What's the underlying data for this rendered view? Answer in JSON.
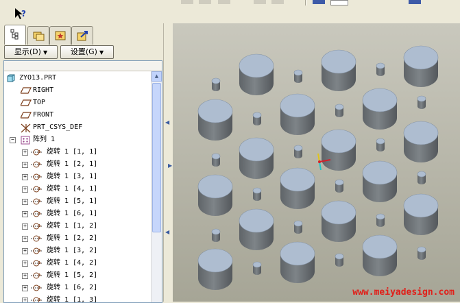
{
  "navigator": {
    "display_label": "显示",
    "display_key": "(D)",
    "settings_label": "设置",
    "settings_key": "(G)"
  },
  "tree": {
    "root": "ZYO13.PRT",
    "items": [
      {
        "label": "RIGHT",
        "type": "datum-plane"
      },
      {
        "label": "TOP",
        "type": "datum-plane"
      },
      {
        "label": "FRONT",
        "type": "datum-plane"
      },
      {
        "label": "PRT_CSYS_DEF",
        "type": "csys"
      }
    ],
    "pattern": {
      "label": "阵列 1",
      "children": [
        "旋转 1 [1, 1]",
        "旋转 1 [2, 1]",
        "旋转 1 [3, 1]",
        "旋转 1 [4, 1]",
        "旋转 1 [5, 1]",
        "旋转 1 [6, 1]",
        "旋转 1 [1, 2]",
        "旋转 1 [2, 2]",
        "旋转 1 [3, 2]",
        "旋转 1 [4, 2]",
        "旋转 1 [5, 2]",
        "旋转 1 [6, 2]",
        "旋转 1 [1, 3]"
      ]
    }
  },
  "watermark": "www.meiyadesign.com",
  "colors": {
    "viewport_top": "#c9c8bd",
    "viewport_bottom": "#a6a596",
    "cylinder_top": "#aebdd0",
    "cylinder_side": "#6f7478",
    "watermark": "#e0201a"
  }
}
